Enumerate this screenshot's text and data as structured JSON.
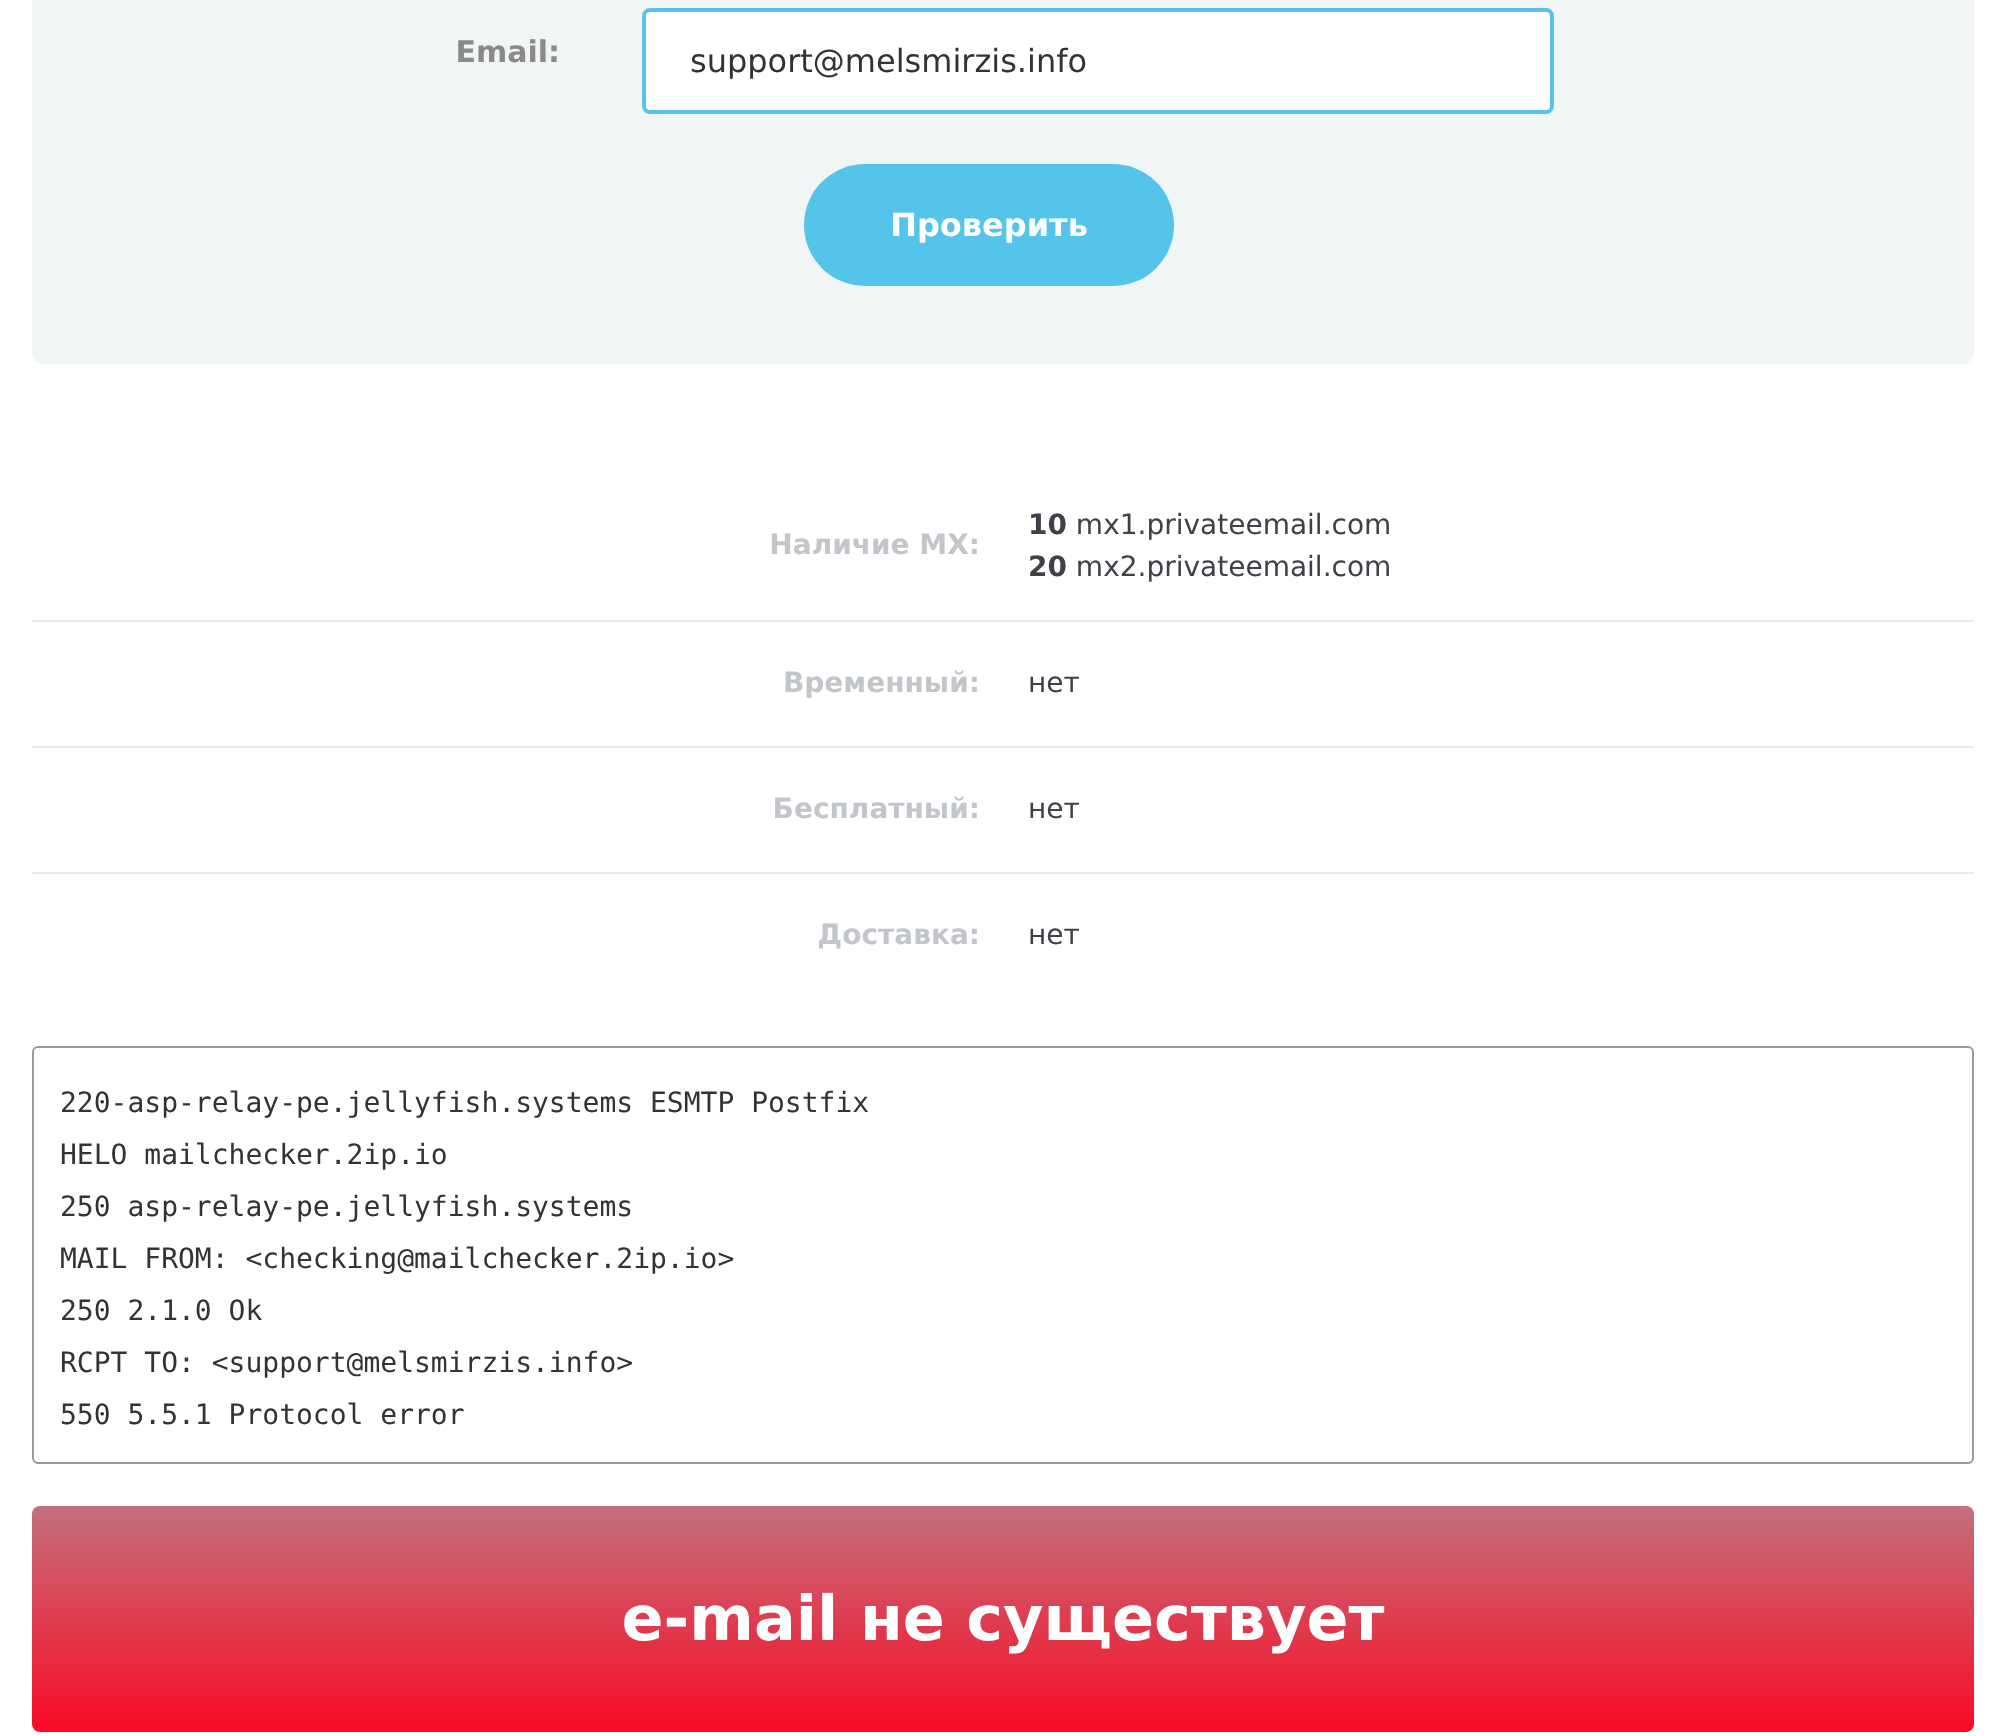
{
  "form": {
    "email_label": "Email:",
    "email_value": "support@melsmirzis.info",
    "submit_button": "Проверить"
  },
  "results": [
    {
      "label": "Наличие MX:",
      "values": [
        "**10** mx1.privateemail.com",
        "**20** mx2.privateemail.com"
      ]
    },
    {
      "label": "Временный:",
      "values": [
        "нет"
      ]
    },
    {
      "label": "Бесплатный:",
      "values": [
        "нет"
      ]
    },
    {
      "label": "Доставка:",
      "values": [
        "нет"
      ]
    }
  ],
  "smtp_log": [
    "220-asp-relay-pe.jellyfish.systems ESMTP Postfix",
    "HELO mailchecker.2ip.io",
    "250 asp-relay-pe.jellyfish.systems",
    "MAIL FROM: <checking@mailchecker.2ip.io>",
    "250 2.1.0 Ok",
    "RCPT TO: <support@melsmirzis.info>",
    "550 5.5.1 Protocol error"
  ],
  "verdict": {
    "text": "e-mail не существует"
  }
}
